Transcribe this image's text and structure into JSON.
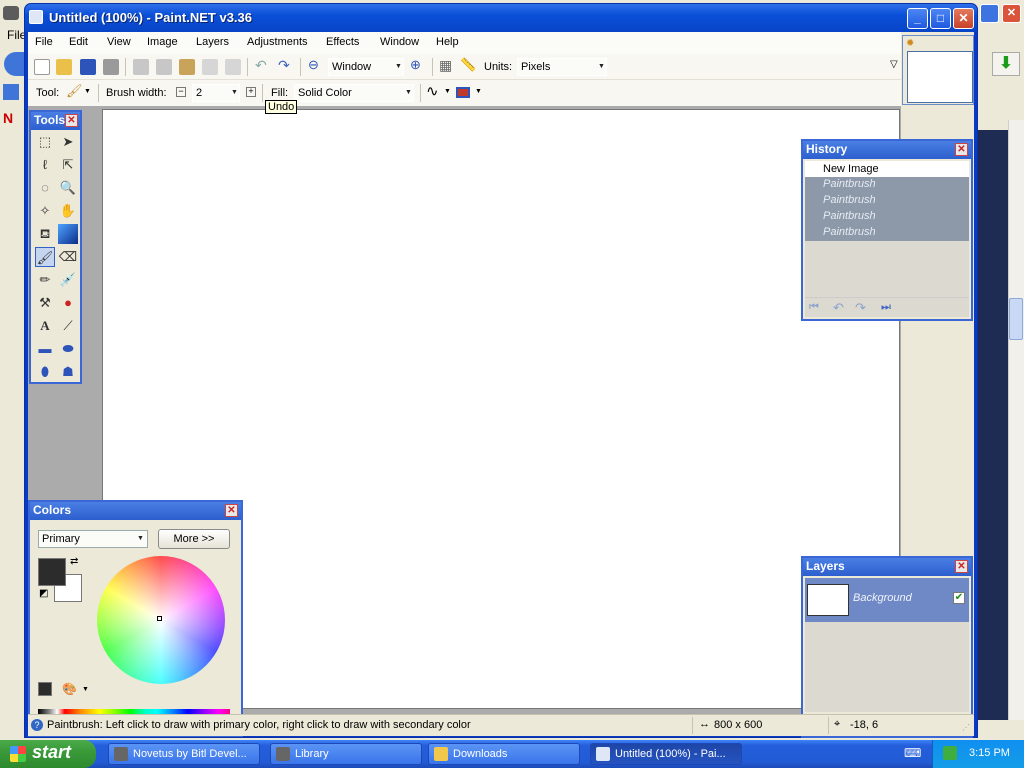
{
  "window": {
    "title": "Untitled (100%) - Paint.NET v3.36",
    "controls": [
      "_",
      "□",
      "✕"
    ]
  },
  "menu": [
    "File",
    "Edit",
    "View",
    "Image",
    "Layers",
    "Adjustments",
    "Effects",
    "Window",
    "Help"
  ],
  "toolbar1": {
    "zoom_value": "Window",
    "units_label": "Units:",
    "units_value": "Pixels"
  },
  "toolbar2": {
    "tool_label": "Tool:",
    "brush_width_label": "Brush width:",
    "brush_width_value": "2",
    "fill_label": "Fill:",
    "fill_value": "Solid Color",
    "tooltip": "Undo"
  },
  "tools_panel": {
    "title": "Tools",
    "close": "✕"
  },
  "history_panel": {
    "title": "History",
    "close": "✕",
    "items": [
      "New Image",
      "Paintbrush",
      "Paintbrush",
      "Paintbrush",
      "Paintbrush"
    ]
  },
  "layers_panel": {
    "title": "Layers",
    "close": "✕",
    "layer_name": "Background",
    "layer_checked": "✔"
  },
  "colors_panel": {
    "title": "Colors",
    "close": "✕",
    "select_value": "Primary",
    "more_button": "More >>",
    "primary_color": "#2c2c2c",
    "secondary_color": "#ffffff"
  },
  "status": {
    "message": "Paintbrush: Left click to draw with primary color, right click to draw with secondary color",
    "image_size": "800 x 600",
    "cursor_pos": "-18, 6"
  },
  "background_app": {
    "menu_text": "File"
  },
  "taskbar": {
    "start_label": "start",
    "tasks": [
      "Novetus by Bitl Devel...",
      "Library",
      "Downloads",
      "Untitled (100%) - Pai..."
    ],
    "clock": "3:15 PM"
  },
  "colors": {
    "accent": "#0a4fd8",
    "panel_title": "#2c5fce",
    "taskbar": "#245edb",
    "start": "#3a9a3a"
  }
}
